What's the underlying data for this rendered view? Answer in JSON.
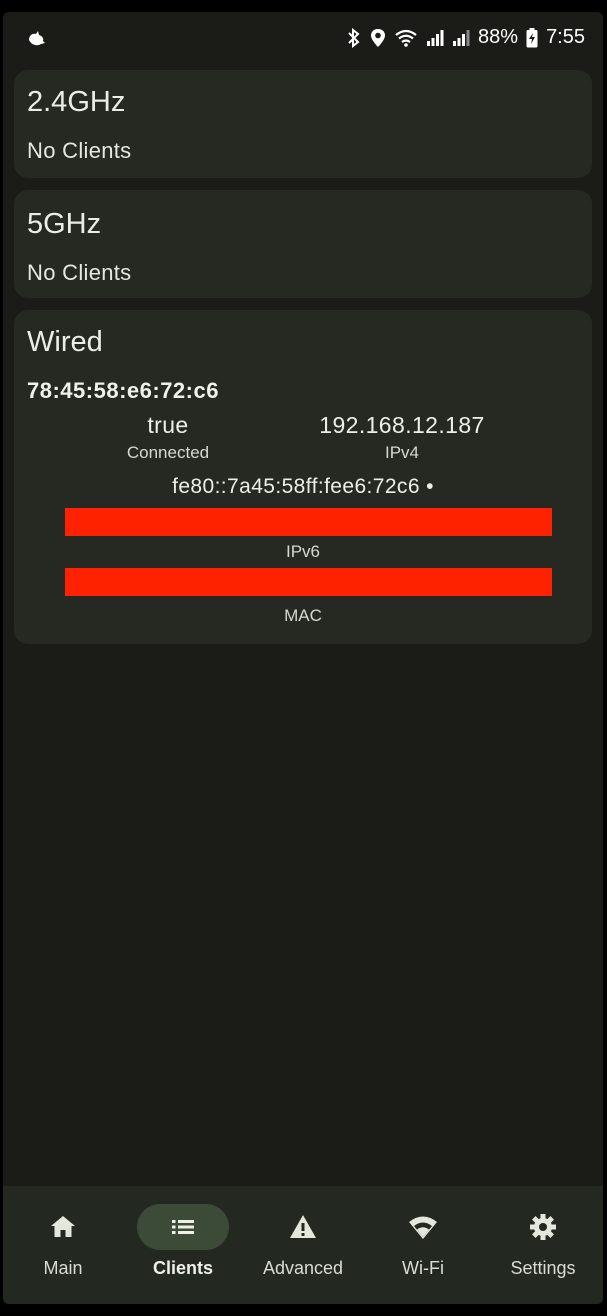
{
  "status_bar": {
    "battery_percent": "88%",
    "time": "7:55",
    "icons": [
      "app-notification-icon",
      "bluetooth-icon",
      "location-icon",
      "wifi-icon",
      "signal-icon",
      "signal-icon",
      "battery-charging-icon"
    ]
  },
  "bands": [
    {
      "title": "2.4GHz",
      "status": "No Clients"
    },
    {
      "title": "5GHz",
      "status": "No Clients"
    }
  ],
  "wired": {
    "title": "Wired",
    "mac_heading": "78:45:58:e6:72:c6",
    "connected_value": "true",
    "connected_label": "Connected",
    "ipv4_value": "192.168.12.187",
    "ipv4_label": "IPv4",
    "ipv6_value": "fe80::7a45:58ff:fee6:72c6 •",
    "ipv6_label": "IPv6",
    "mac_label": "MAC",
    "redaction_color": "#ff2200"
  },
  "nav": {
    "items": [
      {
        "label": "Main",
        "icon": "home-icon"
      },
      {
        "label": "Clients",
        "icon": "list-icon"
      },
      {
        "label": "Advanced",
        "icon": "warning-icon"
      },
      {
        "label": "Wi-Fi",
        "icon": "wifi-icon"
      },
      {
        "label": "Settings",
        "icon": "gear-icon"
      }
    ],
    "active": "Clients"
  },
  "colors": {
    "background": "#1b1c17",
    "card": "#252922",
    "nav_background": "#232820",
    "active_pill": "#3c4a38"
  }
}
